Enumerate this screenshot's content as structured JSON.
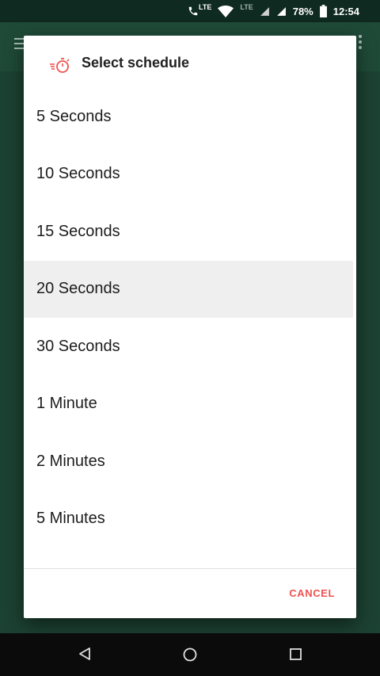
{
  "status_bar": {
    "network_label": "LTE",
    "network_label_2": "LTE",
    "battery": "78%",
    "time": "12:54"
  },
  "dialog": {
    "title": "Select schedule",
    "options": [
      {
        "label": "5 Seconds",
        "selected": false
      },
      {
        "label": "10 Seconds",
        "selected": false
      },
      {
        "label": "15 Seconds",
        "selected": false
      },
      {
        "label": "20 Seconds",
        "selected": true
      },
      {
        "label": "30 Seconds",
        "selected": false
      },
      {
        "label": "1 Minute",
        "selected": false
      },
      {
        "label": "2 Minutes",
        "selected": false
      },
      {
        "label": "5 Minutes",
        "selected": false
      }
    ],
    "cancel_label": "CANCEL"
  },
  "colors": {
    "accent": "#ef5350",
    "app_bar": "#1f4a38",
    "background": "#1c4233",
    "selected_row": "#efefef"
  },
  "icons": {
    "status": [
      "phone-lte-icon",
      "wifi-icon",
      "signal-icon",
      "signal-icon",
      "battery-icon"
    ],
    "dialog": "timer-icon",
    "nav": [
      "back-icon",
      "home-icon",
      "recents-icon"
    ]
  }
}
